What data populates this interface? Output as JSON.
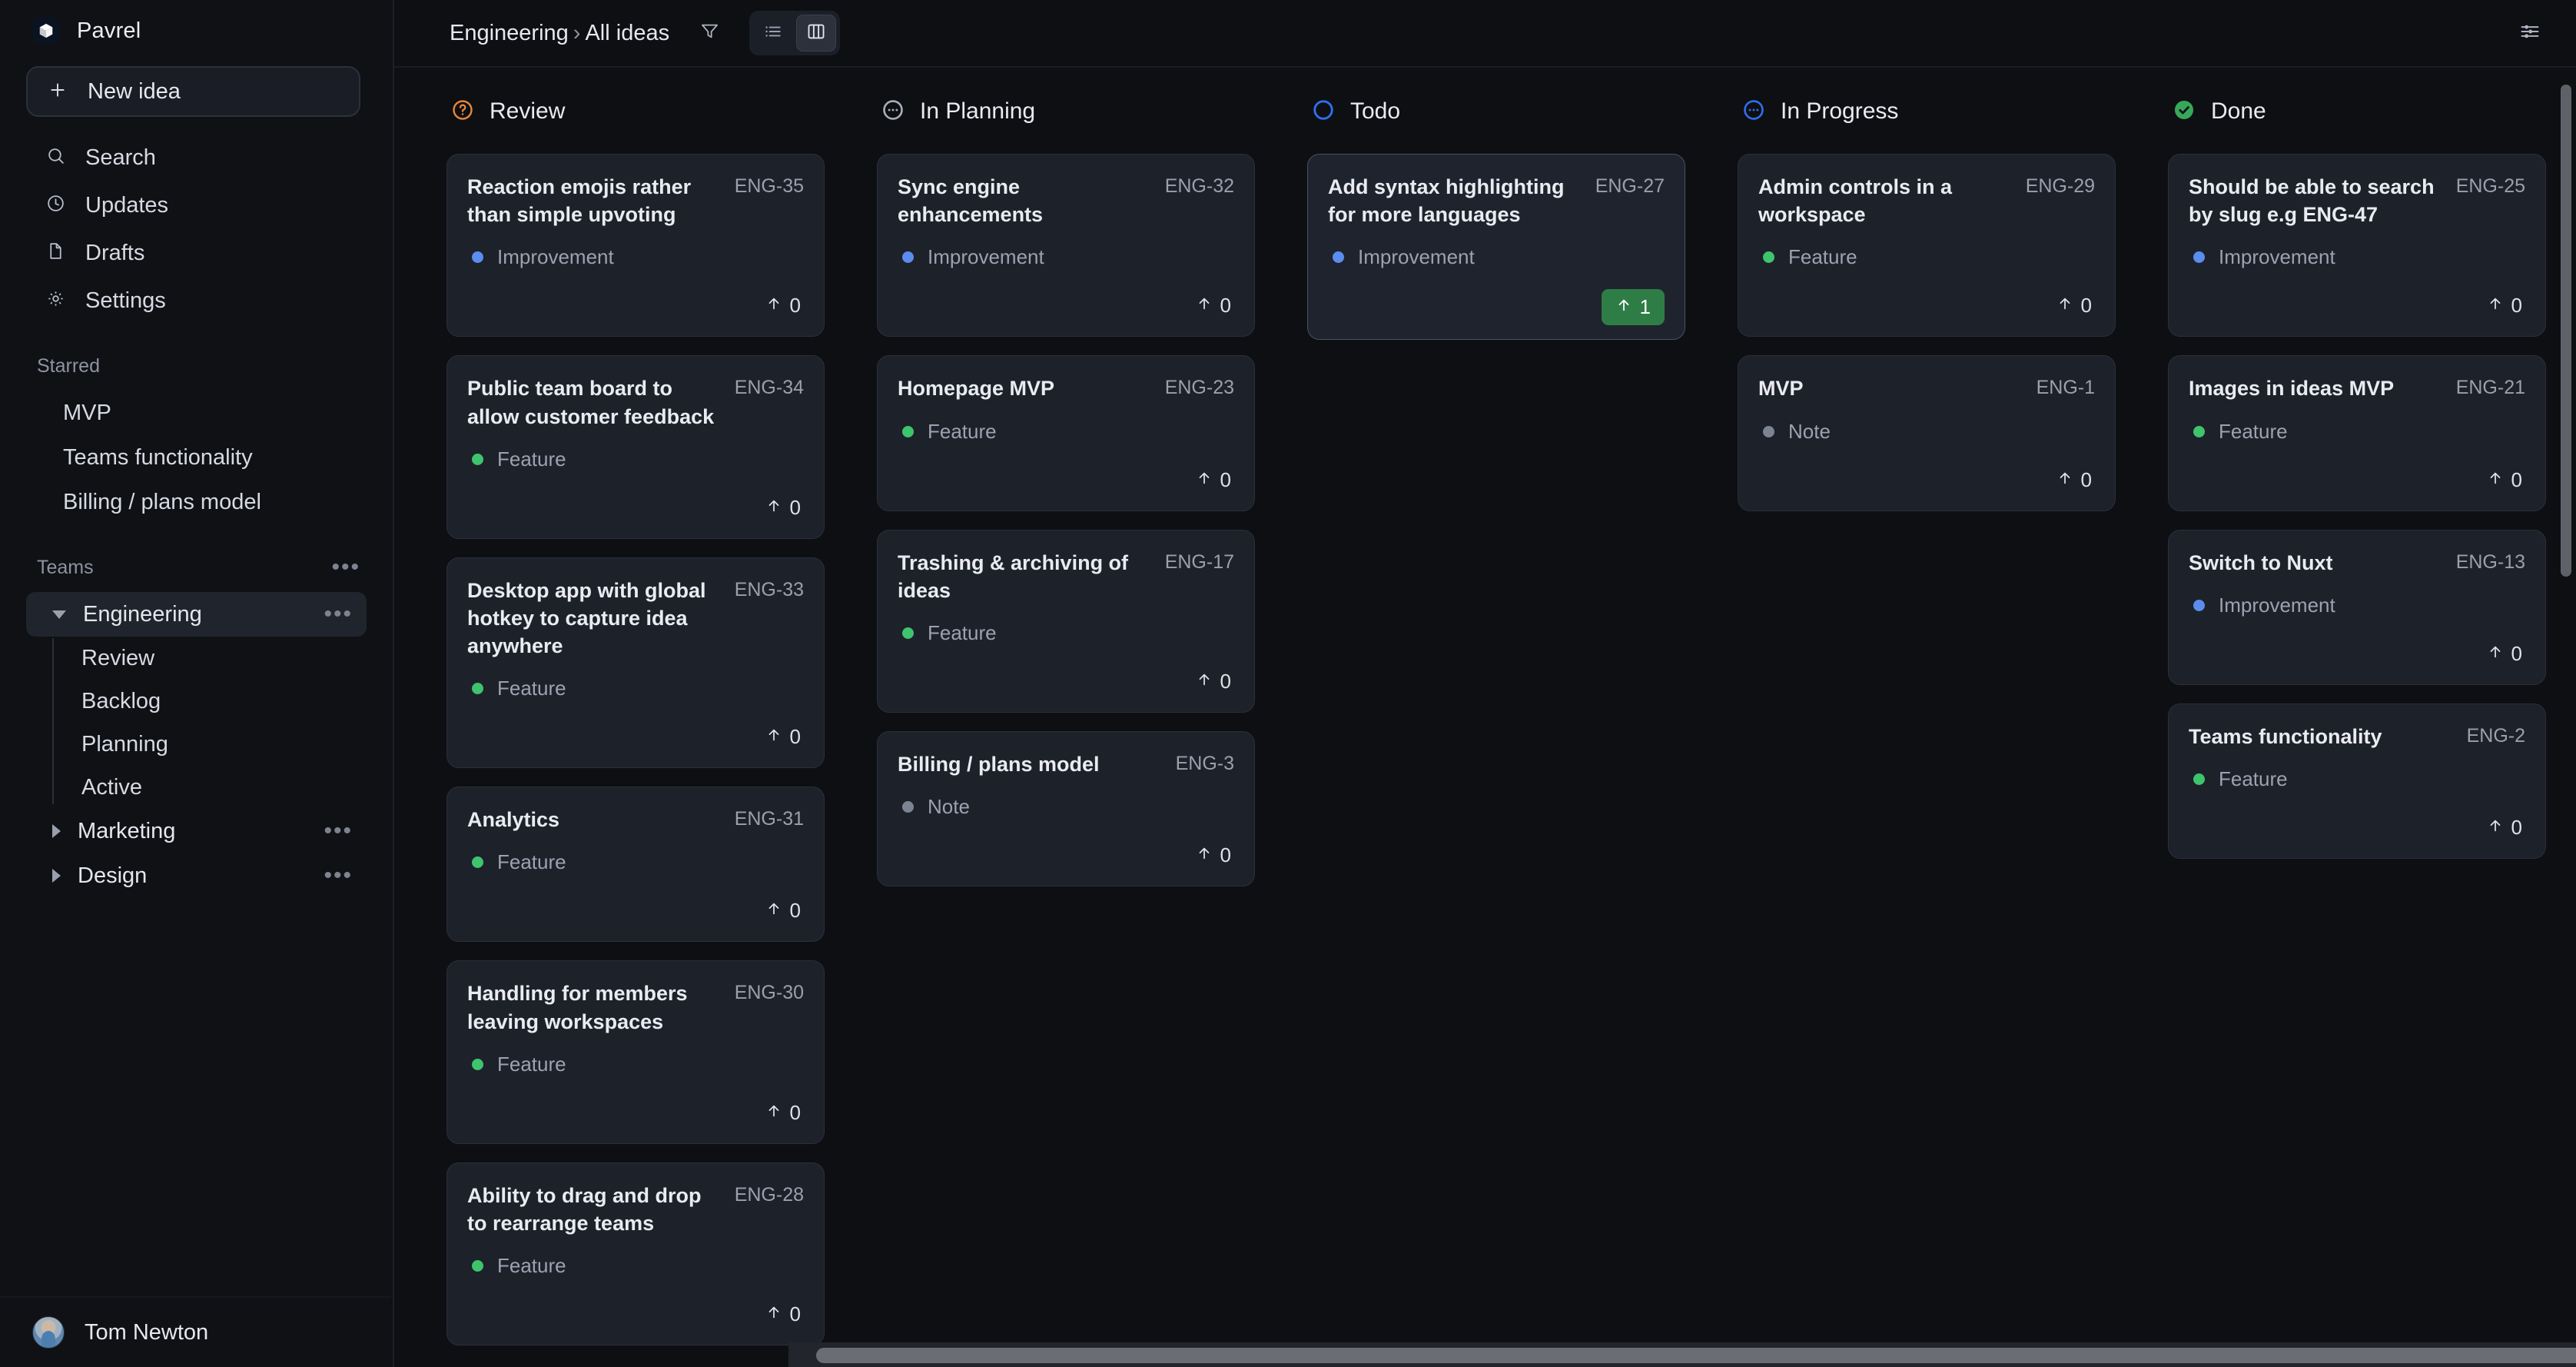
{
  "app": {
    "brand": "Pavrel",
    "logo_icon": "cube-icon"
  },
  "sidebar": {
    "new_idea": {
      "label": "New idea",
      "icon": "plus-icon"
    },
    "nav": [
      {
        "label": "Search",
        "icon": "search-icon"
      },
      {
        "label": "Updates",
        "icon": "clock-icon"
      },
      {
        "label": "Drafts",
        "icon": "document-icon"
      },
      {
        "label": "Settings",
        "icon": "gear-icon"
      }
    ],
    "starred": {
      "heading": "Starred",
      "items": [
        {
          "label": "MVP"
        },
        {
          "label": "Teams functionality"
        },
        {
          "label": "Billing / plans model"
        }
      ]
    },
    "teams": {
      "heading": "Teams",
      "more_icon": "ellipsis-icon",
      "items": [
        {
          "label": "Engineering",
          "expanded": true,
          "active": true,
          "more_icon": "ellipsis-icon",
          "children": [
            {
              "label": "Review"
            },
            {
              "label": "Backlog"
            },
            {
              "label": "Planning"
            },
            {
              "label": "Active"
            }
          ]
        },
        {
          "label": "Marketing",
          "expanded": false,
          "active": false,
          "more_icon": "ellipsis-icon",
          "children": []
        },
        {
          "label": "Design",
          "expanded": false,
          "active": false,
          "more_icon": "ellipsis-icon",
          "children": []
        }
      ]
    },
    "user": {
      "name": "Tom Newton",
      "avatar_icon": "avatar"
    }
  },
  "topbar": {
    "breadcrumb": {
      "team": "Engineering",
      "separator": "›",
      "view": "All ideas"
    },
    "filter_icon": "filter-icon",
    "view_list_icon": "list-view-icon",
    "view_board_icon": "board-view-icon",
    "active_view": "board",
    "settings_icon": "sliders-icon"
  },
  "colors": {
    "type_feature": "#3ec46d",
    "type_improvement": "#5b8def",
    "type_note": "#7c8494",
    "status_review": "#e8883a",
    "status_in_planning": "#a8aeba",
    "status_todo": "#2f6fed",
    "status_in_progress": "#2f6fed",
    "status_done": "#37a85a",
    "vote_badge": "#2f7d46"
  },
  "board": {
    "upvote_icon": "arrow-up-icon",
    "columns": [
      {
        "title": "Review",
        "status_icon": "question-circle-icon",
        "status_color": "#e8883a",
        "cards": [
          {
            "title": "Reaction emojis rather than simple upvoting",
            "slug": "ENG-35",
            "type": "Improvement",
            "type_color": "#5b8def",
            "votes": "0",
            "voted": false,
            "highlight": false
          },
          {
            "title": "Public team board to allow customer feedback",
            "slug": "ENG-34",
            "type": "Feature",
            "type_color": "#3ec46d",
            "votes": "0",
            "voted": false,
            "highlight": false
          },
          {
            "title": "Desktop app with global hotkey to capture idea anywhere",
            "slug": "ENG-33",
            "type": "Feature",
            "type_color": "#3ec46d",
            "votes": "0",
            "voted": false,
            "highlight": false
          },
          {
            "title": "Analytics",
            "slug": "ENG-31",
            "type": "Feature",
            "type_color": "#3ec46d",
            "votes": "0",
            "voted": false,
            "highlight": false
          },
          {
            "title": "Handling for members leaving workspaces",
            "slug": "ENG-30",
            "type": "Feature",
            "type_color": "#3ec46d",
            "votes": "0",
            "voted": false,
            "highlight": false
          },
          {
            "title": "Ability to drag and drop to rearrange teams",
            "slug": "ENG-28",
            "type": "Feature",
            "type_color": "#3ec46d",
            "votes": "0",
            "voted": false,
            "highlight": false
          }
        ]
      },
      {
        "title": "In Planning",
        "status_icon": "dots-circle-icon",
        "status_color": "#a8aeba",
        "cards": [
          {
            "title": "Sync engine enhancements",
            "slug": "ENG-32",
            "type": "Improvement",
            "type_color": "#5b8def",
            "votes": "0",
            "voted": false,
            "highlight": false
          },
          {
            "title": "Homepage MVP",
            "slug": "ENG-23",
            "type": "Feature",
            "type_color": "#3ec46d",
            "votes": "0",
            "voted": false,
            "highlight": false
          },
          {
            "title": "Trashing & archiving of ideas",
            "slug": "ENG-17",
            "type": "Feature",
            "type_color": "#3ec46d",
            "votes": "0",
            "voted": false,
            "highlight": false
          },
          {
            "title": "Billing / plans model",
            "slug": "ENG-3",
            "type": "Note",
            "type_color": "#7c8494",
            "votes": "0",
            "voted": false,
            "highlight": false
          }
        ]
      },
      {
        "title": "Todo",
        "status_icon": "empty-circle-icon",
        "status_color": "#2f6fed",
        "cards": [
          {
            "title": "Add syntax highlighting for more languages",
            "slug": "ENG-27",
            "type": "Improvement",
            "type_color": "#5b8def",
            "votes": "1",
            "voted": true,
            "highlight": true
          }
        ]
      },
      {
        "title": "In Progress",
        "status_icon": "dots-circle-icon",
        "status_color": "#2f6fed",
        "cards": [
          {
            "title": "Admin controls in a workspace",
            "slug": "ENG-29",
            "type": "Feature",
            "type_color": "#3ec46d",
            "votes": "0",
            "voted": false,
            "highlight": false
          },
          {
            "title": "MVP",
            "slug": "ENG-1",
            "type": "Note",
            "type_color": "#7c8494",
            "votes": "0",
            "voted": false,
            "highlight": false
          }
        ]
      },
      {
        "title": "Done",
        "status_icon": "check-circle-icon",
        "status_color": "#37a85a",
        "cards": [
          {
            "title": "Should be able to search by slug e.g ENG-47",
            "slug": "ENG-25",
            "type": "Improvement",
            "type_color": "#5b8def",
            "votes": "0",
            "voted": false,
            "highlight": false
          },
          {
            "title": "Images in ideas MVP",
            "slug": "ENG-21",
            "type": "Feature",
            "type_color": "#3ec46d",
            "votes": "0",
            "voted": false,
            "highlight": false
          },
          {
            "title": "Switch to Nuxt",
            "slug": "ENG-13",
            "type": "Improvement",
            "type_color": "#5b8def",
            "votes": "0",
            "voted": false,
            "highlight": false
          },
          {
            "title": "Teams functionality",
            "slug": "ENG-2",
            "type": "Feature",
            "type_color": "#3ec46d",
            "votes": "0",
            "voted": false,
            "highlight": false
          }
        ]
      }
    ]
  }
}
